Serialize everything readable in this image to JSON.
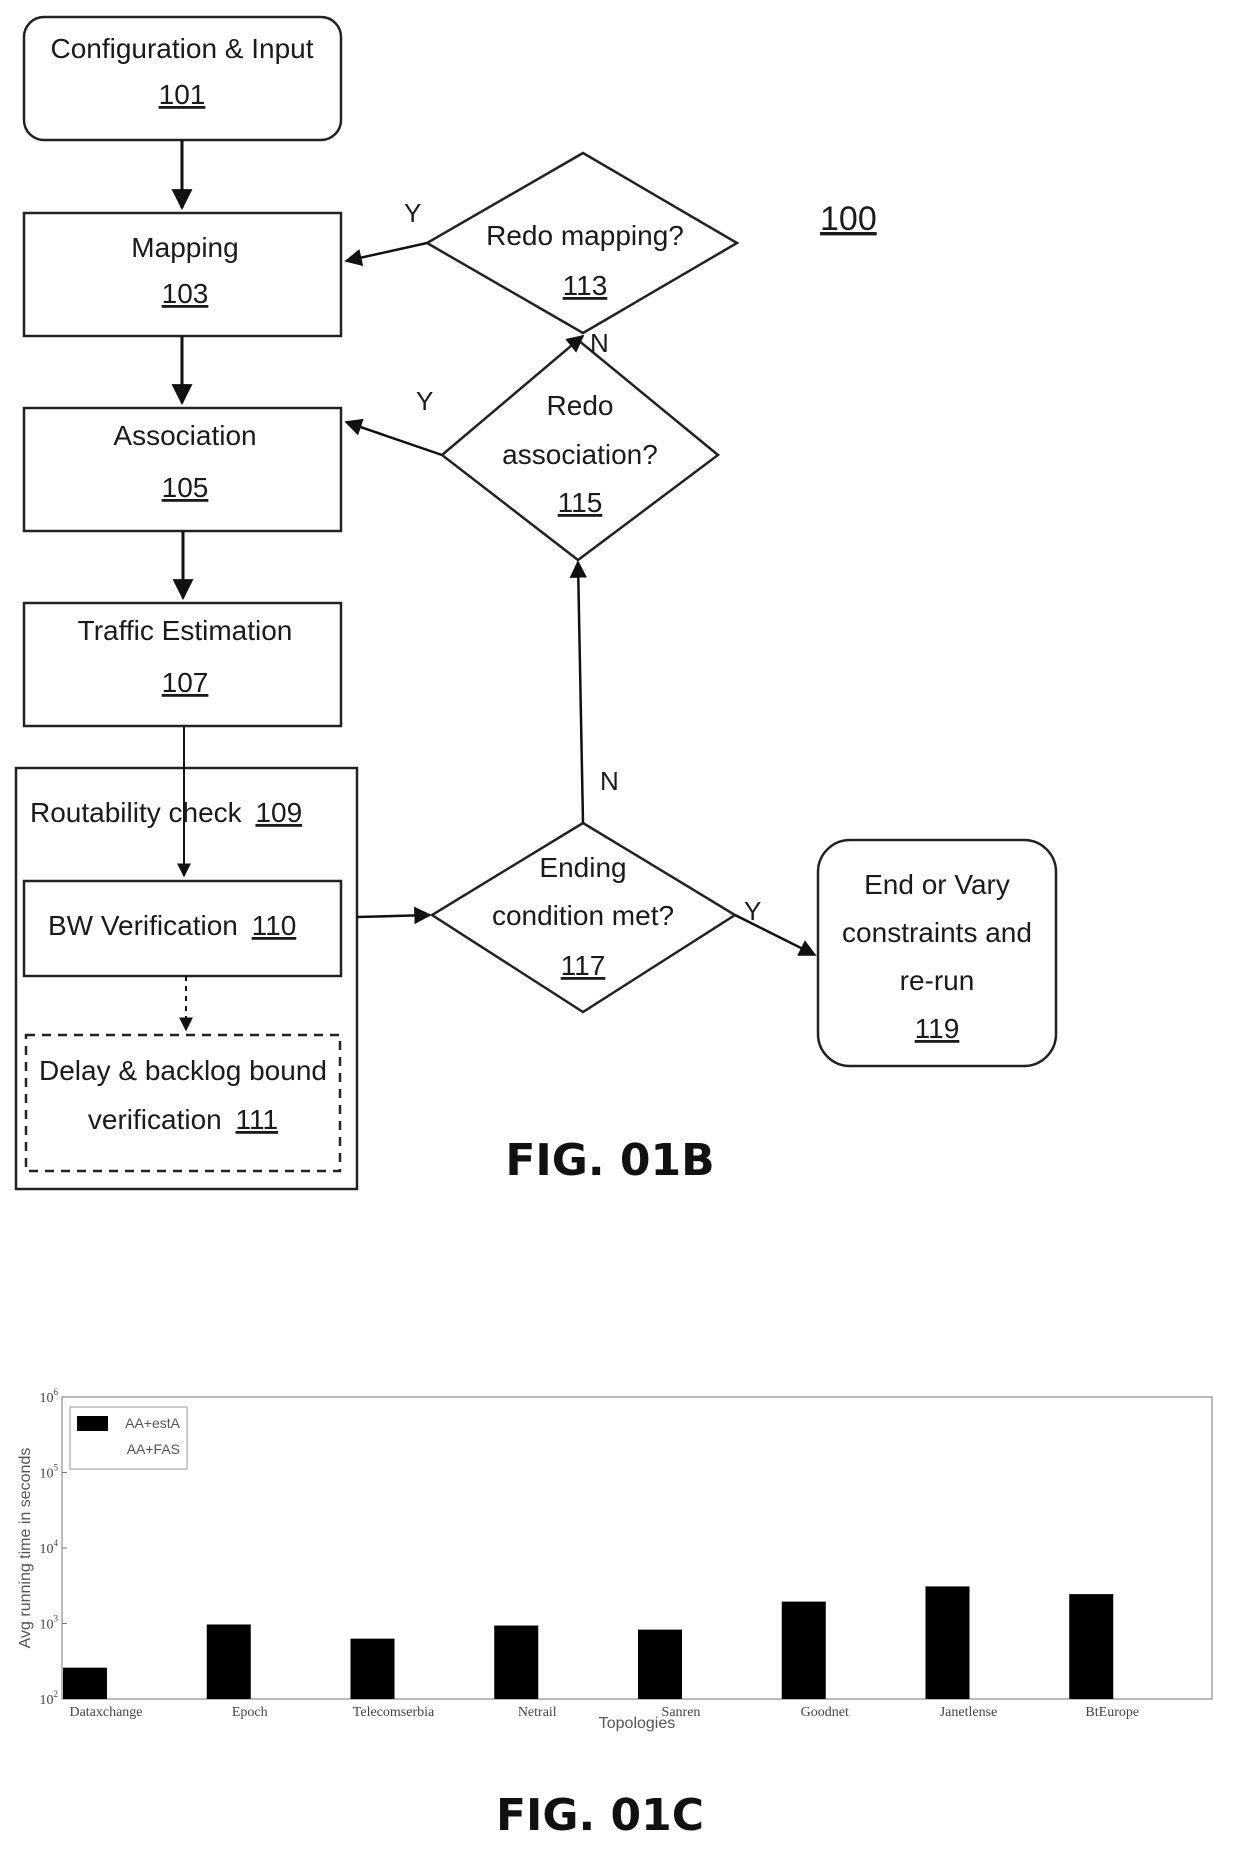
{
  "figure_b": {
    "caption": "FIG. 01B",
    "ref_label": "100",
    "nodes": {
      "config": {
        "title": "Configuration & Input",
        "ref": "101"
      },
      "mapping": {
        "title": "Mapping",
        "ref": "103"
      },
      "association": {
        "title": "Association",
        "ref": "105"
      },
      "traffic": {
        "title": "Traffic Estimation",
        "ref": "107"
      },
      "routability": {
        "title": "Routability  check",
        "ref": "109"
      },
      "bw": {
        "title": "BW Verification",
        "ref": "110"
      },
      "delay": {
        "title_line1": "Delay & backlog bound",
        "title_line2": "verification",
        "ref": "111"
      },
      "redo_mapping": {
        "title": "Redo mapping?",
        "ref": "113"
      },
      "redo_assoc": {
        "title_line1": "Redo",
        "title_line2": "association?",
        "ref": "115"
      },
      "ending": {
        "title_line1": "Ending",
        "title_line2": "condition met?",
        "ref": "117"
      },
      "end": {
        "title_line1": "End or Vary",
        "title_line2": "constraints and",
        "title_line3": "re-run",
        "ref": "119"
      }
    },
    "edge_labels": {
      "redo_mapping_yes": "Y",
      "redo_mapping_no": "N",
      "redo_assoc_yes": "Y",
      "ending_no": "N",
      "ending_yes": "Y"
    }
  },
  "figure_c": {
    "caption": "FIG. 01C"
  },
  "chart_data": {
    "type": "bar",
    "title": "",
    "xlabel": "Topologies",
    "ylabel": "Avg running time in seconds",
    "yscale": "log",
    "ylim": [
      100,
      1000000
    ],
    "yticks": [
      {
        "base": "10",
        "exp": "2",
        "value": 100
      },
      {
        "base": "10",
        "exp": "3",
        "value": 1000
      },
      {
        "base": "10",
        "exp": "4",
        "value": 10000
      },
      {
        "base": "10",
        "exp": "5",
        "value": 100000
      },
      {
        "base": "10",
        "exp": "6",
        "value": 1000000
      }
    ],
    "grid": false,
    "legend_position": "top-left",
    "categories": [
      "Dataxchange",
      "Epoch",
      "Telecomserbia",
      "Netrail",
      "Sanren",
      "Goodnet",
      "Janetlense",
      "BtEurope"
    ],
    "series": [
      {
        "name": "AA+estA",
        "color": "#000000",
        "values": [
          260,
          970,
          630,
          940,
          830,
          1950,
          3100,
          2450
        ]
      },
      {
        "name": "AA+FAS",
        "color": "#ffffff",
        "values": [
          null,
          null,
          null,
          null,
          null,
          null,
          null,
          null
        ]
      }
    ]
  }
}
